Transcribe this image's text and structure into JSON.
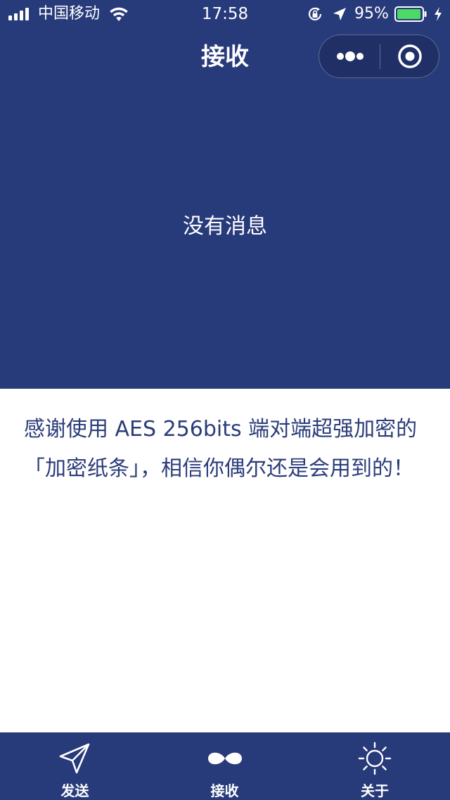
{
  "status_bar": {
    "carrier": "中国移动",
    "time": "17:58",
    "battery_percent": "95%",
    "signal_icon": "signal-bars-icon",
    "wifi_icon": "wifi-icon",
    "rotation_lock_icon": "rotation-lock-icon",
    "location_icon": "location-arrow-icon",
    "battery_icon": "battery-icon",
    "charging_icon": "charging-bolt-icon"
  },
  "nav": {
    "title": "接收",
    "more_icon": "more-dots-icon",
    "close_icon": "circle-target-icon"
  },
  "main": {
    "empty_message": "没有消息",
    "thanks_text": "感谢使用 AES 256bits 端对端超强加密的「加密纸条」，相信你偶尔还是会用到的！"
  },
  "tabs": [
    {
      "label": "发送",
      "icon": "send-icon",
      "selected": false
    },
    {
      "label": "接收",
      "icon": "infinity-icon",
      "selected": true
    },
    {
      "label": "关于",
      "icon": "sun-icon",
      "selected": false
    }
  ],
  "colors": {
    "primary": "#273a7a",
    "text_dark": "#2b3c7a",
    "battery": "#4cd964"
  }
}
